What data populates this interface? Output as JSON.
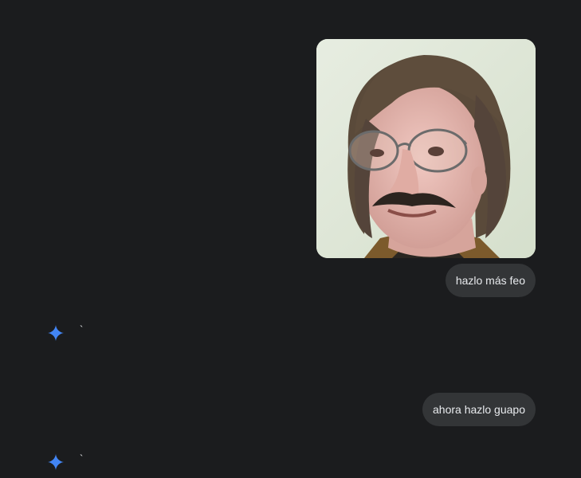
{
  "messages": [
    {
      "role": "user",
      "type": "image",
      "icon": "person-photo"
    },
    {
      "role": "user",
      "type": "text",
      "text": "hazlo más feo"
    },
    {
      "role": "assistant",
      "icon": "gemini-spark-icon",
      "text": "`"
    },
    {
      "role": "user",
      "type": "text",
      "text": "ahora hazlo guapo"
    },
    {
      "role": "assistant",
      "icon": "gemini-spark-icon",
      "text": "`"
    }
  ],
  "colors": {
    "background": "#1b1c1e",
    "bubble": "#333537",
    "text": "#e8eaed",
    "accent": "#4285f4"
  }
}
